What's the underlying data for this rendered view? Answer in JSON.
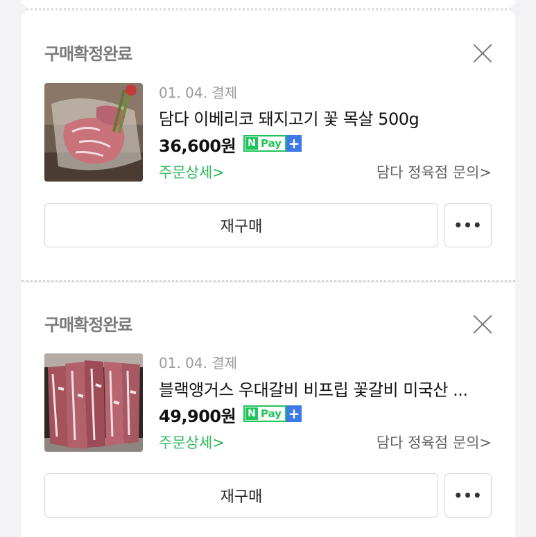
{
  "orders": [
    {
      "status": "구매확정완료",
      "date": "01. 04. 결제",
      "title": "담다 이베리코 돼지고기 꽃 목살 500g",
      "price": "36,600원",
      "npay_label": "Pay",
      "npay_n": "N",
      "npay_plus": "+",
      "detail_link": "주문상세>",
      "inquiry_link": "담다 정육점 문의>",
      "rebuy_label": "재구매",
      "more_label": "•••",
      "thumbnail_icon": "pork-neck-image"
    },
    {
      "status": "구매확정완료",
      "date": "01. 04. 결제",
      "title": "블랙앵거스 우대갈비 비프립 꽃갈비 미국산 ...",
      "price": "49,900원",
      "npay_label": "Pay",
      "npay_n": "N",
      "npay_plus": "+",
      "detail_link": "주문상세>",
      "inquiry_link": "담다 정육점 문의>",
      "rebuy_label": "재구매",
      "more_label": "•••",
      "thumbnail_icon": "beef-ribs-image"
    }
  ],
  "colors": {
    "npay_green": "#1fc45a",
    "npay_blue": "#3d7ae8",
    "detail_green": "#2db85c"
  }
}
